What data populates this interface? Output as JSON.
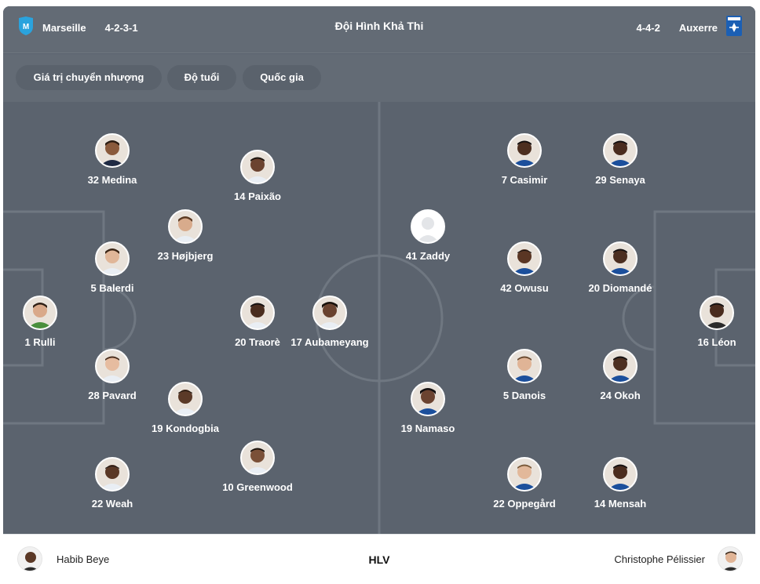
{
  "header": {
    "title": "Đội Hình Khả Thi",
    "home_team": {
      "name": "Marseille",
      "formation": "4-2-3-1",
      "crest_icon": "marseille-crest-icon",
      "crest_color": "#2aa3dd"
    },
    "away_team": {
      "name": "Auxerre",
      "formation": "4-4-2",
      "crest_icon": "auxerre-crest-icon",
      "crest_color": "#1b5fb4"
    }
  },
  "filters": [
    "Giá trị chuyển nhượng",
    "Độ tuổi",
    "Quốc gia"
  ],
  "home_players": [
    {
      "label": "32 Medina"
    },
    {
      "label": "14 Paixão"
    },
    {
      "label": "23 Højbjerg"
    },
    {
      "label": "5 Balerdi"
    },
    {
      "label": "1 Rulli"
    },
    {
      "label": "20 Traorè"
    },
    {
      "label": "17 Aubameyang"
    },
    {
      "label": "28 Pavard"
    },
    {
      "label": "19 Kondogbia"
    },
    {
      "label": "10 Greenwood"
    },
    {
      "label": "22 Weah"
    }
  ],
  "away_players": [
    {
      "label": "7 Casimir"
    },
    {
      "label": "29 Senaya"
    },
    {
      "label": "41 Zaddy",
      "placeholder_photo": true
    },
    {
      "label": "42 Owusu"
    },
    {
      "label": "20 Diomandé"
    },
    {
      "label": "16 Léon"
    },
    {
      "label": "5 Danois"
    },
    {
      "label": "24 Okoh"
    },
    {
      "label": "19 Namaso"
    },
    {
      "label": "22 Oppegård"
    },
    {
      "label": "14 Mensah"
    }
  ],
  "coaches": {
    "label": "HLV",
    "home": "Habib Beye",
    "away": "Christophe Pélissier"
  },
  "colors": {
    "pitch": "#5b636e",
    "bar": "#636b75",
    "lines": "#6f7781"
  }
}
